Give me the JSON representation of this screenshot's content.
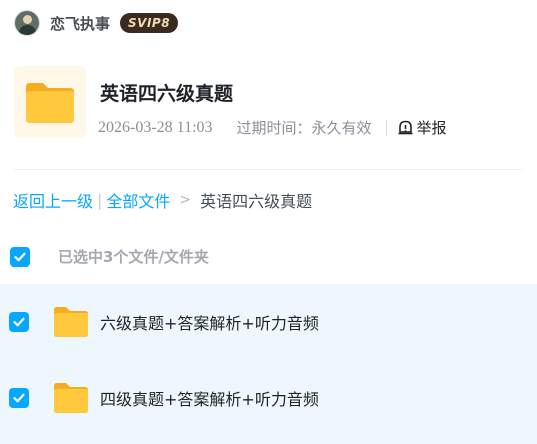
{
  "user": {
    "avatar_icon": "avatar-photo",
    "name": "恋飞执事",
    "vip_badge": "SVIP8"
  },
  "share": {
    "folder_icon": "folder-icon",
    "title": "英语四六级真题",
    "created_time": "2026-03-28 11:03",
    "expire_text": "过期时间：永久有效",
    "report_icon": "report-icon",
    "report_label": "举报"
  },
  "breadcrumb": {
    "back_label": "返回上一级",
    "separator": "|",
    "all_files_label": "全部文件",
    "arrow": ">",
    "current": "英语四六级真题"
  },
  "selection": {
    "checked": true,
    "summary": "已选中3个文件/文件夹"
  },
  "files": [
    {
      "name": "六级真题+答案解析+听力音频",
      "type": "folder",
      "checked": true
    },
    {
      "name": "四级真题+答案解析+听力音频",
      "type": "folder",
      "checked": true
    }
  ],
  "colors": {
    "accent": "#06a7ff",
    "folder": "#ffc83d",
    "vip_badge_bg": "#3a2a20",
    "vip_badge_text": "#f3d9b4",
    "list_bg": "#eef7fd"
  }
}
